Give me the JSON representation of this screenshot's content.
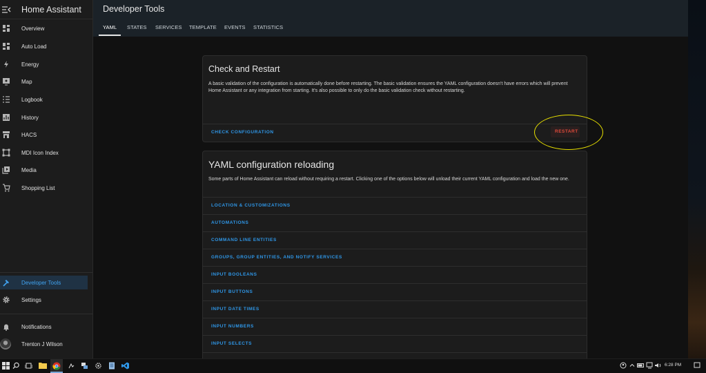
{
  "sidebar": {
    "title": "Home Assistant",
    "items": [
      {
        "label": "Overview",
        "icon": "dashboard-icon"
      },
      {
        "label": "Auto Load",
        "icon": "dashboard-icon"
      },
      {
        "label": "Energy",
        "icon": "lightning-icon"
      },
      {
        "label": "Map",
        "icon": "map-icon"
      },
      {
        "label": "Logbook",
        "icon": "list-icon"
      },
      {
        "label": "History",
        "icon": "chart-icon"
      },
      {
        "label": "HACS",
        "icon": "store-icon"
      },
      {
        "label": "MDI Icon Index",
        "icon": "icon-index-icon"
      },
      {
        "label": "Media",
        "icon": "media-icon"
      },
      {
        "label": "Shopping List",
        "icon": "cart-icon"
      }
    ],
    "developer_tools": "Developer Tools",
    "settings": "Settings",
    "notifications": "Notifications",
    "user": "Trenton J Wilson"
  },
  "header": {
    "title": "Developer Tools",
    "tabs": [
      "YAML",
      "STATES",
      "SERVICES",
      "TEMPLATE",
      "EVENTS",
      "STATISTICS"
    ],
    "active_tab": "YAML"
  },
  "check_card": {
    "title": "Check and Restart",
    "text": "A basic validation of the configuration is automatically done before restarting. The basic validation ensures the YAML configuration doesn't have errors which will prevent Home Assistant or any integration from starting. It's also possible to only do the basic validation check without restarting.",
    "check_label": "CHECK CONFIGURATION",
    "restart_label": "RESTART"
  },
  "reload_card": {
    "title": "YAML configuration reloading",
    "text": "Some parts of Home Assistant can reload without requiring a restart. Clicking one of the options below will unload their current YAML configuration and load the new one.",
    "items": [
      "LOCATION & CUSTOMIZATIONS",
      "AUTOMATIONS",
      "COMMAND LINE ENTITIES",
      "GROUPS, GROUP ENTITIES, AND NOTIFY SERVICES",
      "INPUT BOOLEANS",
      "INPUT BUTTONS",
      "INPUT DATE TIMES",
      "INPUT NUMBERS",
      "INPUT SELECTS"
    ]
  },
  "taskbar": {
    "clock": "6:28 PM"
  },
  "colors": {
    "accent": "#2f97e8",
    "restart": "#e04a3a",
    "highlight": "#e8e000"
  }
}
